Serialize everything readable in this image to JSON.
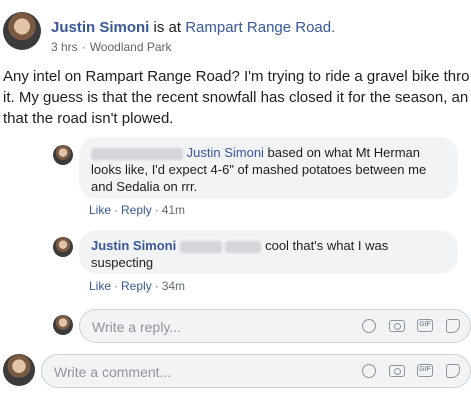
{
  "post": {
    "author": "Justin Simoni",
    "is_at": " is at ",
    "place": "Rampart Range Road.",
    "time": "3 hrs",
    "separator": "·",
    "location": "Woodland Park",
    "text_lines": [
      "Any intel on Rampart Range Road? I'm trying to ride a gravel bike through",
      "it. My guess is that the recent snowfall has closed it for the season, and",
      "that the road isn't plowed."
    ]
  },
  "comments": [
    {
      "tag": "Justin Simoni",
      "line1_rest": " based on what Mt Herman",
      "line2": "looks like, I'd expect 4-6\" of mashed potatoes between me",
      "line3": "and Sedalia on rrr.",
      "like": "Like",
      "reply": "Reply",
      "sep": "·",
      "time": "41m"
    },
    {
      "author": "Justin Simoni",
      "line1_rest": " cool that's what I was",
      "line2": "suspecting",
      "like": "Like",
      "reply": "Reply",
      "sep": "·",
      "time": "34m"
    }
  ],
  "reply_box": {
    "placeholder": "Write a reply..."
  },
  "comment_box": {
    "placeholder": "Write a comment..."
  },
  "tool_icons": [
    "emoji-icon",
    "camera-icon",
    "gif-icon",
    "sticker-icon"
  ],
  "gif_text": "GIF"
}
